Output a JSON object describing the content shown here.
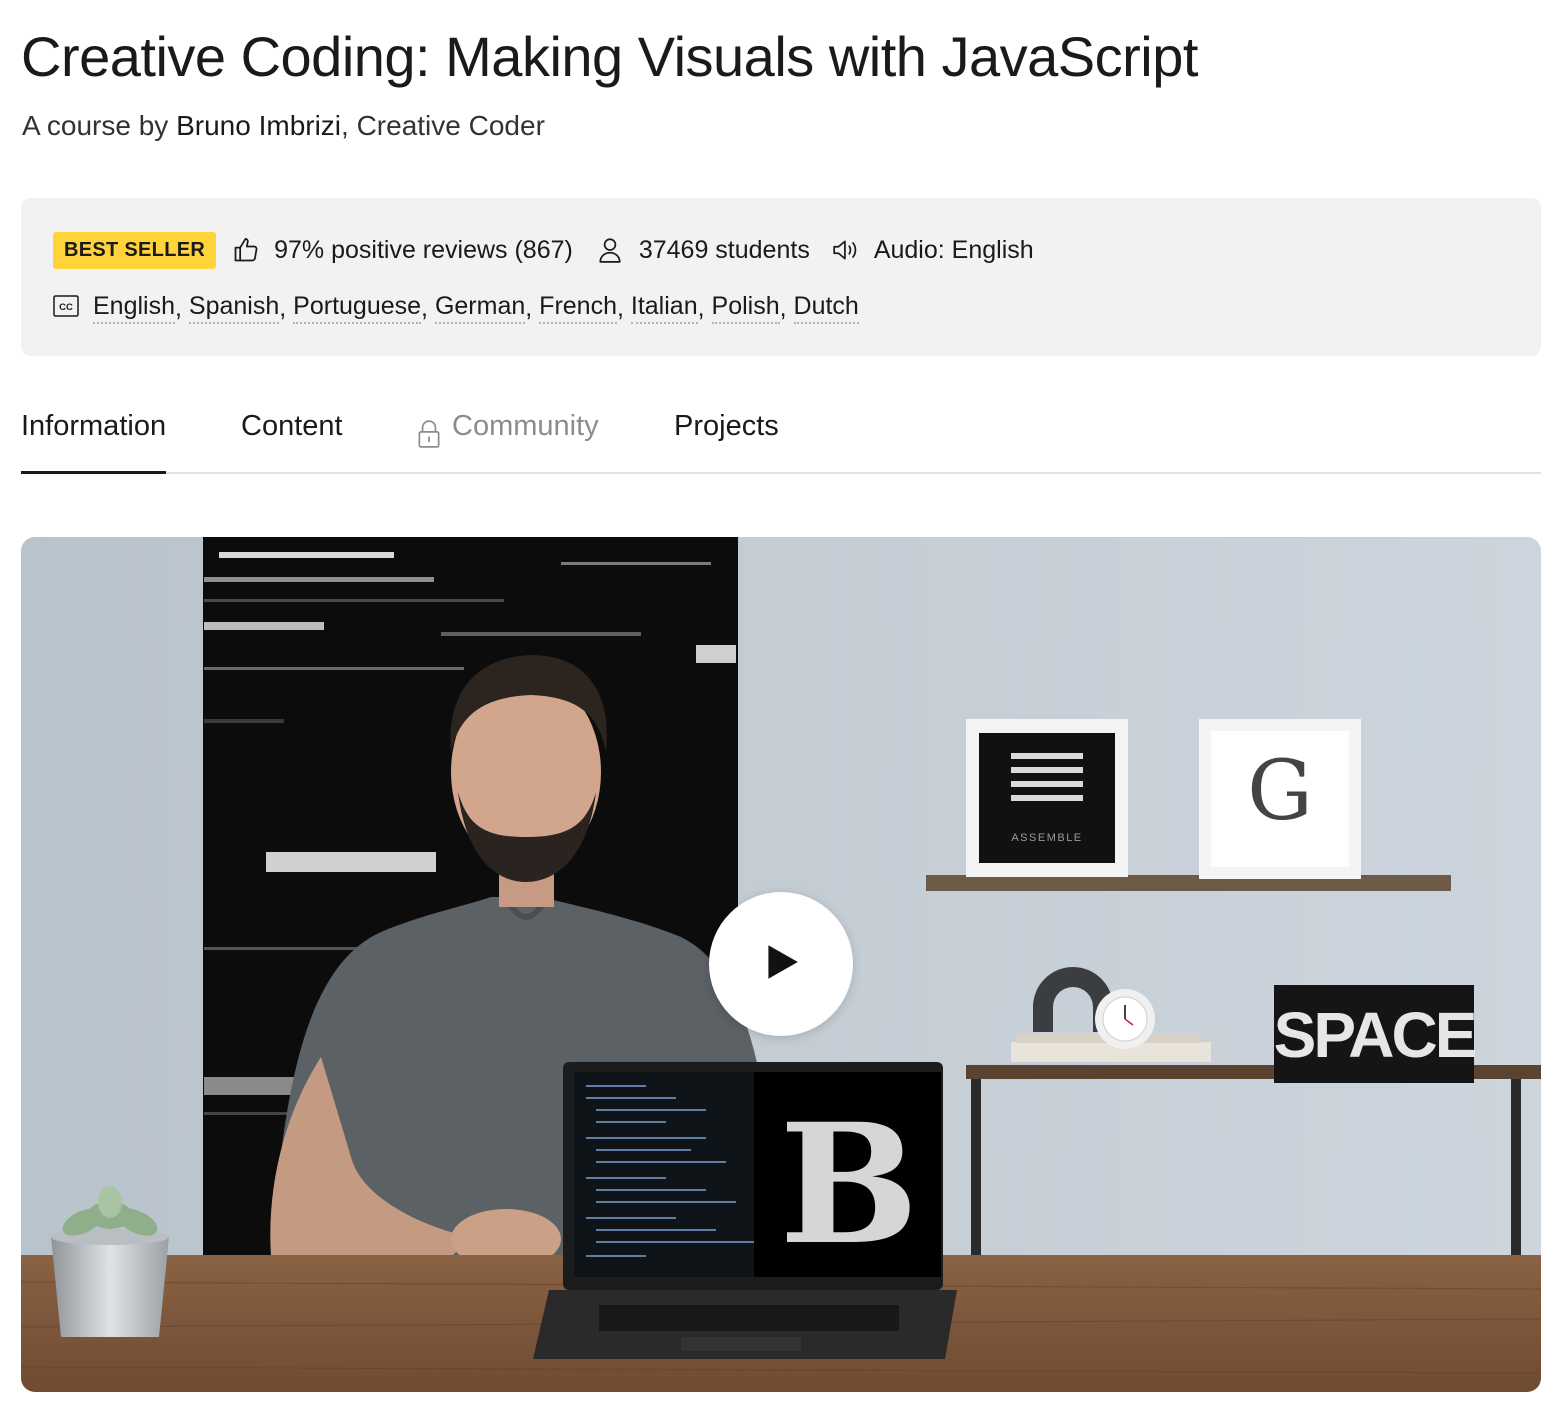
{
  "course": {
    "title": "Creative Coding: Making Visuals with JavaScript",
    "byline_prefix": "A course by ",
    "author": "Bruno Imbrizi",
    "byline_suffix": ", Creative Coder"
  },
  "stats": {
    "badge": "BEST SELLER",
    "reviews": "97% positive reviews (867)",
    "students": "37469 students",
    "audio": "Audio: English",
    "subtitles": [
      "English",
      "Spanish",
      "Portuguese",
      "German",
      "French",
      "Italian",
      "Polish",
      "Dutch"
    ],
    "icons": {
      "reviews": "thumbs-up-icon",
      "students": "user-icon",
      "audio": "speaker-icon",
      "subtitles": "closed-captions-icon"
    }
  },
  "tabs": [
    {
      "label": "Information",
      "active": true
    },
    {
      "label": "Content"
    },
    {
      "label": "Community",
      "locked": true
    },
    {
      "label": "Projects"
    }
  ],
  "hero": {
    "letter_on_laptop": "B",
    "framed_letter": "G",
    "frame_word": "ASSEMBLE",
    "sign_word": "SPACE"
  },
  "colors": {
    "badge": "#ffd43b",
    "stats_bg": "#f2f2f2",
    "text": "#1a1a1a",
    "muted": "#8c8c8c"
  }
}
